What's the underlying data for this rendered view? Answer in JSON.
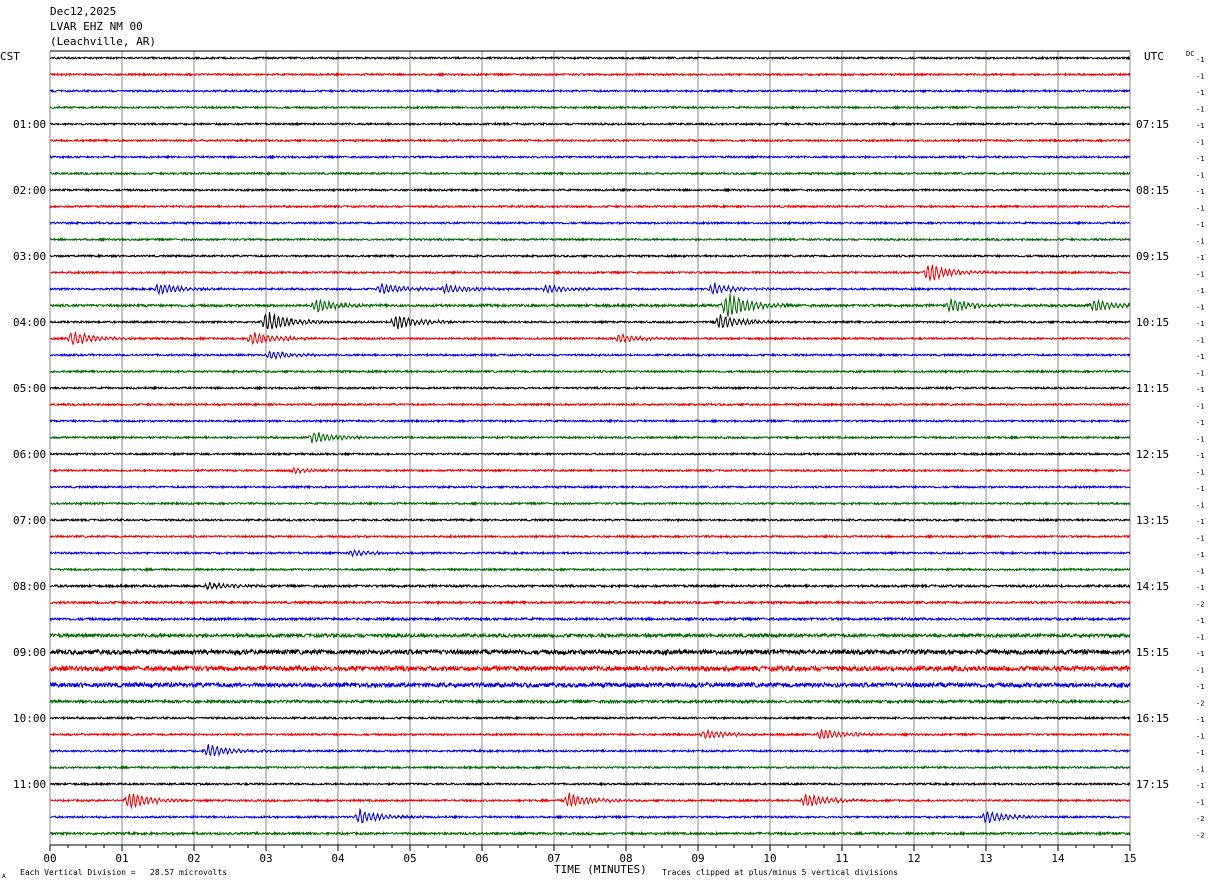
{
  "header": {
    "date": "Dec12,2025",
    "station": "LVAR EHZ NM 00",
    "location": "(Leachville, AR)"
  },
  "labels": {
    "left_tz": "CST",
    "right_tz": "UTC",
    "dc": "DC",
    "x_axis_title": "TIME (MINUTES)",
    "footer_left": "Each Vertical Division =   28.57 microvolts",
    "footer_right": "Traces clipped at plus/minus 5 vertical divisions",
    "footer_mark": "A"
  },
  "chart_data": {
    "type": "line",
    "title": "LVAR EHZ NM 00",
    "xlabel": "TIME (MINUTES)",
    "xlim": [
      0,
      15
    ],
    "x_ticks": [
      "00",
      "01",
      "02",
      "03",
      "04",
      "05",
      "06",
      "07",
      "08",
      "09",
      "10",
      "11",
      "12",
      "13",
      "14",
      "15"
    ],
    "trace_colors": [
      "#000000",
      "#ee0000",
      "#0000dd",
      "#006600"
    ],
    "trace_count": 48,
    "left_hour_labels": [
      "01:00",
      "02:00",
      "03:00",
      "04:00",
      "05:00",
      "06:00",
      "07:00",
      "08:00",
      "09:00",
      "10:00",
      "11:00"
    ],
    "right_hour_labels": [
      "07:15",
      "08:15",
      "09:15",
      "10:15",
      "11:15",
      "12:15",
      "13:15",
      "14:15",
      "15:15",
      "16:15",
      "17:15"
    ],
    "dc_offsets": [
      "-1",
      "-1",
      "-1",
      "-1",
      "-1",
      "-1",
      "-1",
      "-1",
      "-1",
      "-1",
      "-1",
      "-1",
      "-1",
      "-1",
      "-1",
      "-1",
      "-1",
      "-1",
      "-1",
      "-1",
      "-1",
      "-1",
      "-1",
      "-1",
      "-1",
      "-1",
      "-1",
      "-1",
      "-1",
      "-1",
      "-1",
      "-1",
      "-1",
      "-2",
      "-1",
      "-1",
      "-1",
      "-1",
      "-1",
      "-2",
      "-1",
      "-1",
      "-1",
      "-1",
      "-1",
      "-1",
      "-2",
      "-2"
    ],
    "activity": [
      [
        1,
        1,
        1,
        1
      ],
      [
        1,
        1,
        1,
        1
      ],
      [
        1,
        1,
        1,
        1
      ],
      [
        1,
        1,
        1,
        1.3
      ],
      [
        1,
        1,
        1,
        1
      ],
      [
        1,
        1,
        1,
        1
      ],
      [
        1,
        1,
        1,
        1
      ],
      [
        1,
        1,
        1,
        1
      ],
      [
        1.2,
        1.2,
        1.3,
        1.8
      ],
      [
        2.5,
        2.6,
        2.4,
        1.5
      ],
      [
        1,
        1,
        1,
        1
      ],
      [
        1,
        1,
        1,
        1.2
      ],
      [
        1.3,
        1,
        1.5,
        1.2
      ],
      [
        1.5,
        1.5,
        2,
        1.8
      ],
      [
        2,
        2.2,
        2.2,
        2.5
      ],
      [
        2.5,
        2.3,
        3,
        2.5
      ],
      [
        3,
        3,
        3.2,
        3
      ],
      [
        3,
        3,
        3.4,
        3.2
      ],
      [
        3.5,
        4,
        3.6,
        3.4
      ],
      [
        3.2,
        3,
        4,
        3.6
      ],
      [
        3.2,
        4,
        3.8,
        3.6
      ],
      [
        4.2,
        4,
        4.2,
        3.6
      ],
      [
        3.6,
        3.6,
        3.8,
        3.8
      ],
      [
        4.6,
        4.8,
        4.6,
        4.6
      ]
    ],
    "events": [
      {
        "trace": 13,
        "minute": 12.2,
        "amp": 10
      },
      {
        "trace": 14,
        "minute": 1.5,
        "amp": 6
      },
      {
        "trace": 14,
        "minute": 4.6,
        "amp": 6
      },
      {
        "trace": 14,
        "minute": 5.5,
        "amp": 5
      },
      {
        "trace": 14,
        "minute": 6.9,
        "amp": 5
      },
      {
        "trace": 14,
        "minute": 9.2,
        "amp": 6
      },
      {
        "trace": 15,
        "minute": 3.7,
        "amp": 7
      },
      {
        "trace": 15,
        "minute": 9.4,
        "amp": 14
      },
      {
        "trace": 15,
        "minute": 12.5,
        "amp": 7
      },
      {
        "trace": 15,
        "minute": 14.5,
        "amp": 7
      },
      {
        "trace": 16,
        "minute": 3.0,
        "amp": 12
      },
      {
        "trace": 16,
        "minute": 4.8,
        "amp": 8
      },
      {
        "trace": 16,
        "minute": 9.3,
        "amp": 8
      },
      {
        "trace": 17,
        "minute": 0.3,
        "amp": 8
      },
      {
        "trace": 17,
        "minute": 2.8,
        "amp": 8
      },
      {
        "trace": 17,
        "minute": 7.9,
        "amp": 5
      },
      {
        "trace": 18,
        "minute": 3.05,
        "amp": 5
      },
      {
        "trace": 23,
        "minute": 3.65,
        "amp": 6
      },
      {
        "trace": 25,
        "minute": 3.4,
        "amp": 3
      },
      {
        "trace": 30,
        "minute": 4.2,
        "amp": 3
      },
      {
        "trace": 32,
        "minute": 2.2,
        "amp": 4
      },
      {
        "trace": 41,
        "minute": 9.1,
        "amp": 5
      },
      {
        "trace": 41,
        "minute": 10.7,
        "amp": 6
      },
      {
        "trace": 42,
        "minute": 2.2,
        "amp": 7
      },
      {
        "trace": 45,
        "minute": 1.1,
        "amp": 9
      },
      {
        "trace": 45,
        "minute": 7.2,
        "amp": 8
      },
      {
        "trace": 45,
        "minute": 10.5,
        "amp": 8
      },
      {
        "trace": 46,
        "minute": 4.3,
        "amp": 8
      },
      {
        "trace": 46,
        "minute": 13.0,
        "amp": 7
      }
    ]
  }
}
